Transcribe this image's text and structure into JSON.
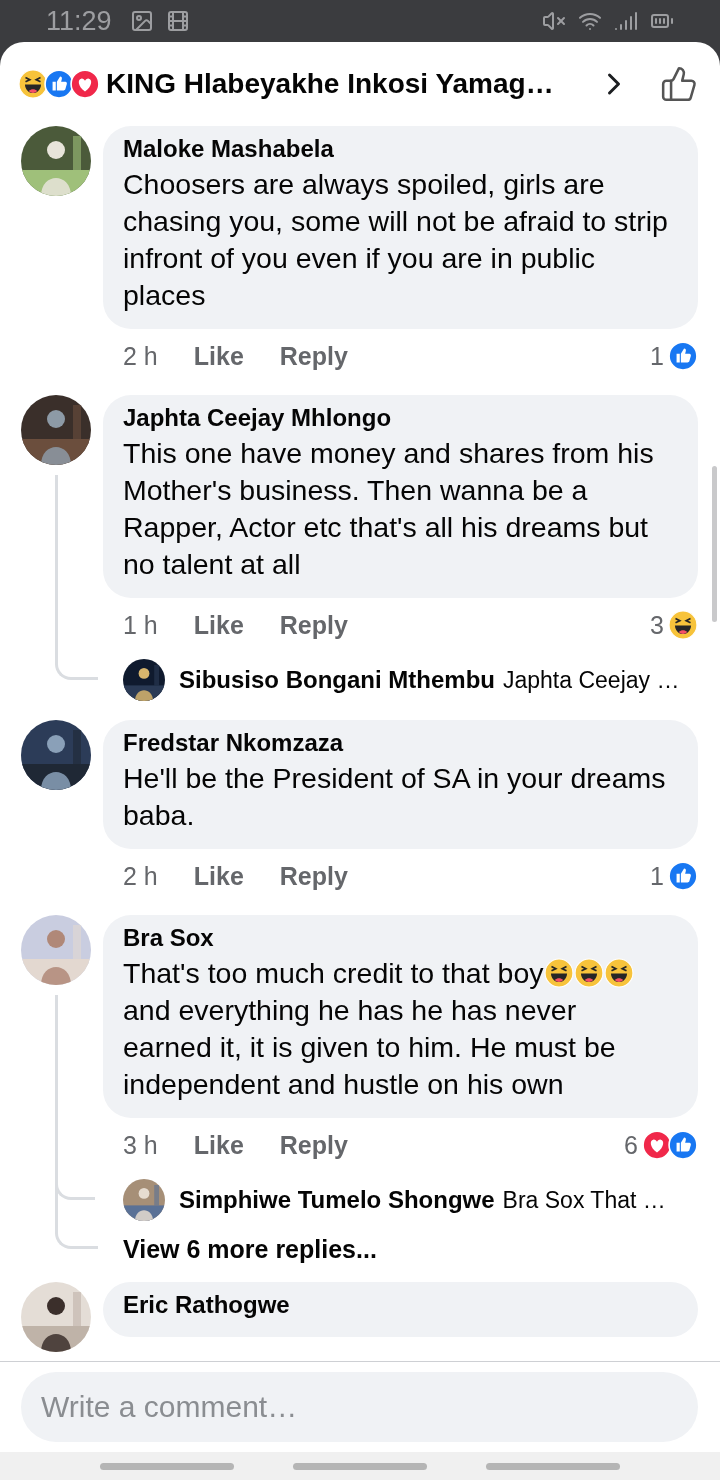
{
  "status_bar": {
    "time": "11:29"
  },
  "header": {
    "reactions": [
      {
        "kind": "haha"
      },
      {
        "kind": "like"
      },
      {
        "kind": "love"
      }
    ],
    "title": "KING Hlabeyakhe Inkosi Yamag…"
  },
  "comments": [
    {
      "author": "Maloke Mashabela",
      "body": [
        {
          "text": "Choosers are always spoiled, girls are chasing you, some will not be afraid to strip infront of you even if you are in public places"
        }
      ],
      "time": "2 h",
      "like": "Like",
      "reply": "Reply",
      "reaction_count": "1",
      "reactions": [
        {
          "kind": "like"
        }
      ]
    },
    {
      "author": "Japhta Ceejay Mhlongo",
      "body": [
        {
          "text": "This one have money and shares from his Mother's business. Then wanna be a Rapper, Actor etc that's all his dreams but no talent at all"
        }
      ],
      "time": "1 h",
      "like": "Like",
      "reply": "Reply",
      "reaction_count": "3",
      "reactions": [
        {
          "kind": "haha"
        }
      ],
      "replies": [
        {
          "kind": "reply",
          "author": "Sibusiso Bongani Mthembu",
          "preview": "Japhta Ceejay …"
        }
      ]
    },
    {
      "author": "Fredstar Nkomzaza",
      "body": [
        {
          "text": "He'll be the President of SA in your dreams baba."
        }
      ],
      "time": "2 h",
      "like": "Like",
      "reply": "Reply",
      "reaction_count": "1",
      "reactions": [
        {
          "kind": "like"
        }
      ]
    },
    {
      "author": "Bra Sox",
      "body": [
        {
          "text": "That's too much credit to that boy"
        },
        {
          "kind": "haha"
        },
        {
          "kind": "haha"
        },
        {
          "kind": "haha"
        },
        {
          "text": " and everything he has he has never earned it, it is given to him. He must be independent and hustle on his own"
        }
      ],
      "time": "3 h",
      "like": "Like",
      "reply": "Reply",
      "reaction_count": "6",
      "reactions": [
        {
          "kind": "love"
        },
        {
          "kind": "like"
        }
      ],
      "replies": [
        {
          "kind": "reply",
          "author": "Simphiwe Tumelo Shongwe",
          "preview": "Bra Sox That …"
        },
        {
          "kind": "more",
          "label": "View 6 more replies..."
        }
      ]
    },
    {
      "author": "Eric Rathogwe"
    }
  ],
  "composer": {
    "placeholder": "Write a comment…"
  }
}
